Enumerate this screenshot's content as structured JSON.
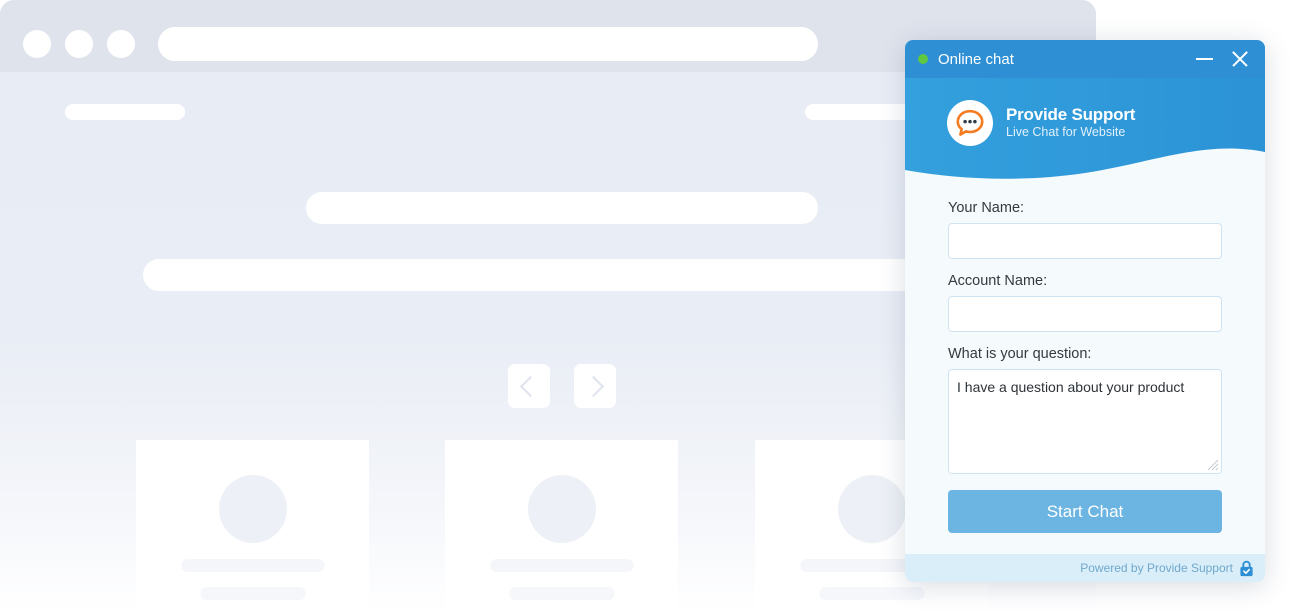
{
  "background_site": {
    "browser_chrome": {
      "traffic_lights": [
        "dot-1",
        "dot-2",
        "dot-3"
      ],
      "address_bar_placeholder": ""
    },
    "carousel": {
      "prev_icon": "chevron-left-icon",
      "next_icon": "chevron-right-icon"
    },
    "cards_count": 3,
    "accent_placeholder_color": "#ffffff",
    "page_background_color": "#e8ecf5"
  },
  "chat_widget": {
    "titlebar": {
      "status": "online",
      "status_color": "#5fc742",
      "title": "Online chat",
      "minimize_icon": "minimize-icon",
      "close_icon": "close-icon",
      "background_color": "#2e8fd4"
    },
    "brand": {
      "logo_icon": "speech-bubble-logo-icon",
      "name": "Provide Support",
      "tagline": "Live Chat for Website",
      "logo_accent_color": "#f47b20"
    },
    "form": {
      "name_label": "Your Name:",
      "name_value": "",
      "name_placeholder": "",
      "account_label": "Account Name:",
      "account_value": "",
      "account_placeholder": "",
      "question_label": "What is your question:",
      "question_value": "I have a question about your product",
      "question_placeholder": "",
      "submit_label": "Start Chat",
      "submit_color": "#6cb5e2"
    },
    "footer": {
      "text": "Powered by Provide Support",
      "lock_icon": "secure-lock-icon",
      "lock_color": "#2e8fd4"
    }
  }
}
